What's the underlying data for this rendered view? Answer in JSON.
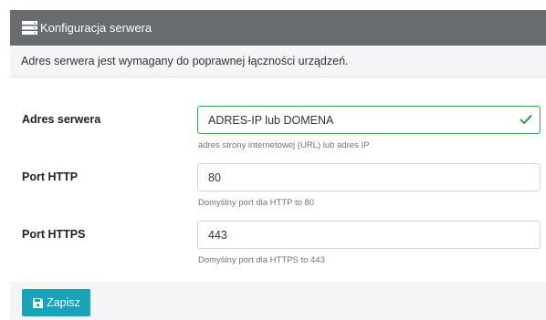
{
  "panel": {
    "title": "Konfiguracja serwera",
    "icon": "server-icon",
    "header_color": "#686c70"
  },
  "intro": "Adres serwera jest wymagany do poprawnej łączności urządzeń.",
  "fields": {
    "server_address": {
      "label": "Adres serwera",
      "value": "ADRES-IP lub DOMENA",
      "help": "adres strony internetowej (URL) lub adres IP",
      "state": "valid"
    },
    "port_http": {
      "label": "Port HTTP",
      "value": "80",
      "help": "Domyślny port dla HTTP to 80"
    },
    "port_https": {
      "label": "Port HTTPS",
      "value": "443",
      "help": "Domyślny port dla HTTPS to 443"
    }
  },
  "footer": {
    "save_label": "Zapisz",
    "save_icon": "floppy-disk-icon",
    "button_color": "#1aa3b8"
  },
  "colors": {
    "valid": "#3ea45a"
  }
}
